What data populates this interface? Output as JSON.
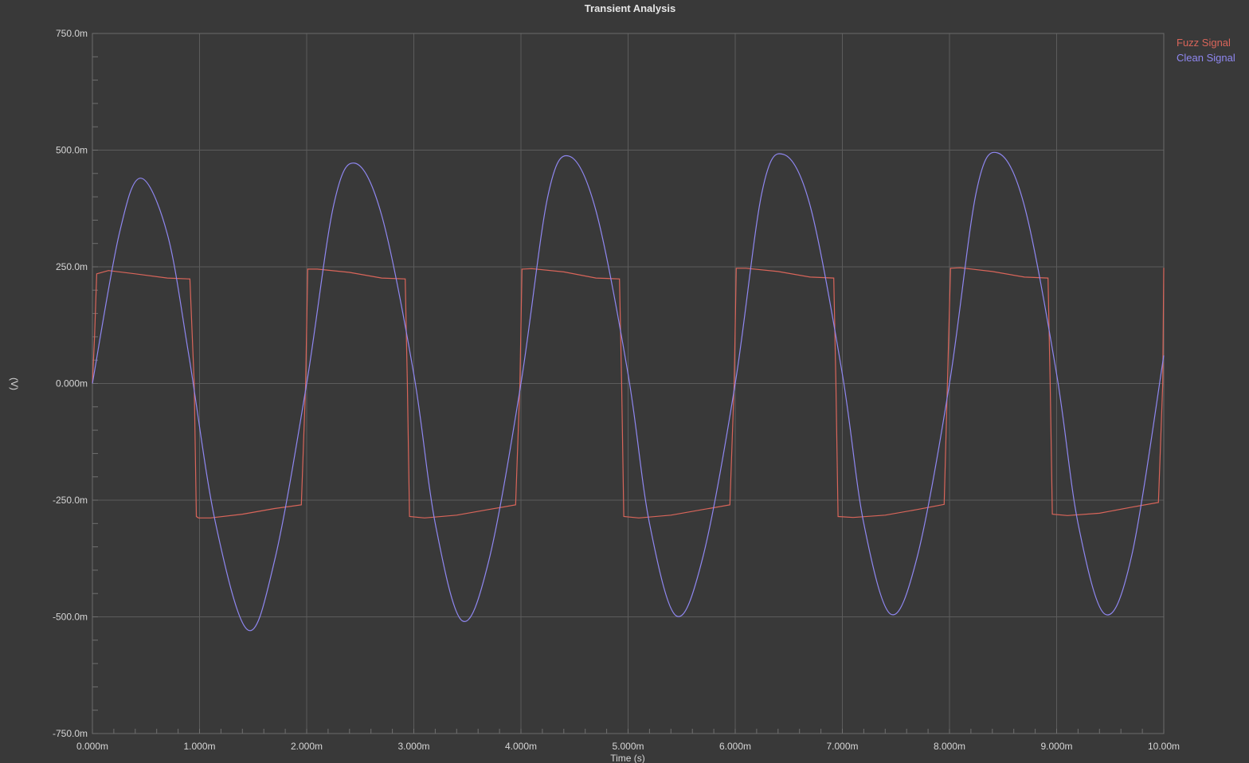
{
  "chart_data": {
    "type": "line",
    "title": "Transient Analysis",
    "xlabel": "Time (s)",
    "ylabel": "(V)",
    "xlim": [
      0,
      0.01
    ],
    "ylim": [
      -0.75,
      0.75
    ],
    "x_ticks": [
      0,
      0.001,
      0.002,
      0.003,
      0.004,
      0.005,
      0.006,
      0.007,
      0.008,
      0.009,
      0.01
    ],
    "x_tick_labels": [
      "0.000m",
      "1.000m",
      "2.000m",
      "3.000m",
      "4.000m",
      "5.000m",
      "6.000m",
      "7.000m",
      "8.000m",
      "9.000m",
      "10.00m"
    ],
    "y_ticks": [
      0.75,
      0.5,
      0.25,
      0,
      -0.25,
      -0.5,
      -0.75
    ],
    "y_tick_labels": [
      "750.0m",
      "500.0m",
      "250.0m",
      "0.000m",
      "-250.0m",
      "-500.0m",
      "-750.0m"
    ],
    "grid": true,
    "legend_position": "top-right",
    "series": [
      {
        "name": "Fuzz Signal",
        "color": "#d9655a",
        "x": [
          0,
          2e-05,
          4e-05,
          0.00015,
          0.0004,
          0.0007,
          0.0009,
          0.00091,
          0.00095,
          0.00097,
          0.00099,
          0.0011,
          0.0014,
          0.0017,
          0.00195,
          0.00199,
          0.00201,
          0.0021,
          0.0024,
          0.0027,
          0.00292,
          0.00294,
          0.00296,
          0.0031,
          0.0034,
          0.0037,
          0.00395,
          0.00399,
          0.00401,
          0.0041,
          0.0044,
          0.0047,
          0.00492,
          0.00494,
          0.00496,
          0.0051,
          0.0054,
          0.0057,
          0.00595,
          0.00599,
          0.00601,
          0.0061,
          0.0064,
          0.0067,
          0.00692,
          0.00694,
          0.00696,
          0.0071,
          0.0074,
          0.0077,
          0.00795,
          0.00599,
          0.00801,
          0.0081,
          0.0084,
          0.0087,
          0.00892,
          0.00894,
          0.00896,
          0.0091,
          0.0094,
          0.0097,
          0.00995,
          0.00999,
          0.01
        ],
        "y": [
          0,
          0.1,
          0.235,
          0.242,
          0.235,
          0.226,
          0.224,
          0.224,
          0.0,
          -0.285,
          -0.288,
          -0.288,
          -0.28,
          -0.268,
          -0.26,
          0.0,
          0.245,
          0.245,
          0.238,
          0.226,
          0.224,
          0.0,
          -0.285,
          -0.288,
          -0.282,
          -0.27,
          -0.26,
          0.0,
          0.245,
          0.246,
          0.239,
          0.226,
          0.224,
          0.0,
          -0.285,
          -0.288,
          -0.282,
          -0.27,
          -0.26,
          0.0,
          0.247,
          0.247,
          0.24,
          0.228,
          0.226,
          0.0,
          -0.285,
          -0.287,
          -0.282,
          -0.27,
          -0.259,
          0.0,
          0.247,
          0.248,
          0.24,
          0.228,
          0.226,
          0.0,
          -0.28,
          -0.283,
          -0.278,
          -0.265,
          -0.255,
          0.0,
          0.248
        ]
      },
      {
        "name": "Clean Signal",
        "color": "#8f87f0",
        "x": [
          0,
          0.00025,
          0.00045,
          0.0007,
          0.0009,
          0.00115,
          0.00145,
          0.0017,
          0.002,
          0.00225,
          0.00245,
          0.0027,
          0.003,
          0.0032,
          0.00345,
          0.0037,
          0.004,
          0.00425,
          0.00445,
          0.0047,
          0.005,
          0.0052,
          0.00545,
          0.0057,
          0.006,
          0.00625,
          0.00645,
          0.0067,
          0.007,
          0.0072,
          0.00745,
          0.0077,
          0.008,
          0.00825,
          0.00845,
          0.0087,
          0.009,
          0.0092,
          0.00945,
          0.0097,
          0.01
        ],
        "y": [
          0,
          0.32,
          0.44,
          0.32,
          0.06,
          -0.3,
          -0.528,
          -0.38,
          0.0,
          0.38,
          0.472,
          0.36,
          0.02,
          -0.3,
          -0.508,
          -0.38,
          0.0,
          0.4,
          0.487,
          0.37,
          0.02,
          -0.3,
          -0.498,
          -0.37,
          0.0,
          0.41,
          0.491,
          0.38,
          0.02,
          -0.3,
          -0.494,
          -0.37,
          0.0,
          0.41,
          0.494,
          0.38,
          0.02,
          -0.3,
          -0.494,
          -0.37,
          0.06
        ]
      }
    ]
  }
}
